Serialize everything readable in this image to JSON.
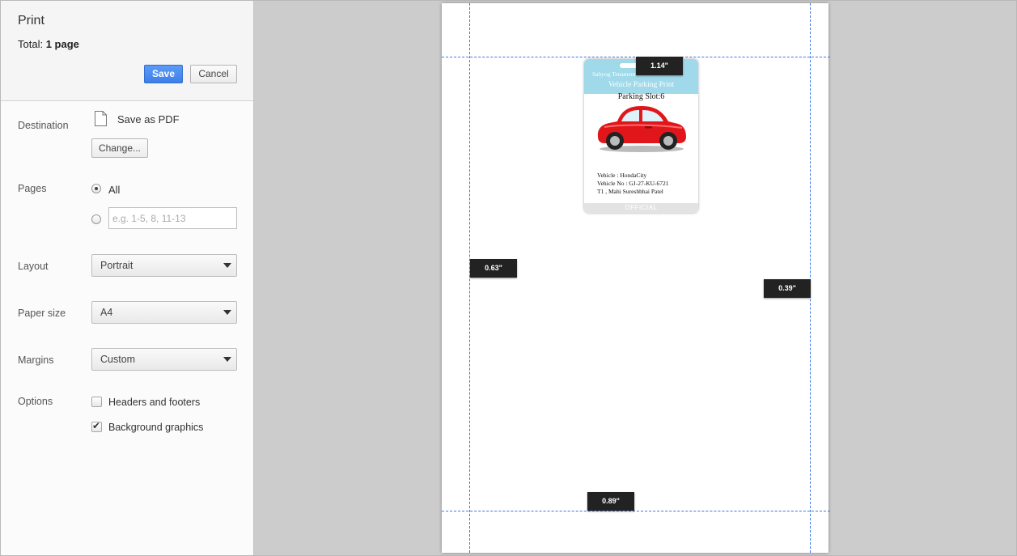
{
  "header": {
    "title": "Print",
    "total_label": "Total:",
    "total_value": "1 page",
    "save_label": "Save",
    "cancel_label": "Cancel"
  },
  "destination": {
    "label": "Destination",
    "name": "Save as PDF",
    "change_label": "Change..."
  },
  "pages": {
    "label": "Pages",
    "all_label": "All",
    "selected": "All",
    "range_value": "",
    "range_placeholder": "e.g. 1-5, 8, 11-13"
  },
  "layout": {
    "label": "Layout",
    "value": "Portrait"
  },
  "paper_size": {
    "label": "Paper size",
    "value": "A4"
  },
  "margins": {
    "label": "Margins",
    "value": "Custom"
  },
  "options": {
    "label": "Options",
    "headers_footers_label": "Headers and footers",
    "headers_footers_checked": false,
    "background_graphics_label": "Background graphics",
    "background_graphics_checked": true
  },
  "preview": {
    "margin_top": "1.14\"",
    "margin_left": "0.63\"",
    "margin_right": "0.39\"",
    "margin_bottom": "0.89\"",
    "guide_color": "#3b78e7",
    "card": {
      "org": "Sahyog Tenament",
      "title": "Vehicle Parking Print",
      "slot": "Parking Slot:6",
      "vehicle": "Vehicle :  HondaCity",
      "vehicle_no": "Vehicle No :  GJ-27-KU-6721",
      "owner": "T1 , Mahi Sureshbhai Patel",
      "footer": "OFFICIAL",
      "header_color": "#9fd9ea",
      "car_color": "#e0161b"
    }
  },
  "colors": {
    "save_button": "#4787ed",
    "preview_background": "#cccccc"
  }
}
